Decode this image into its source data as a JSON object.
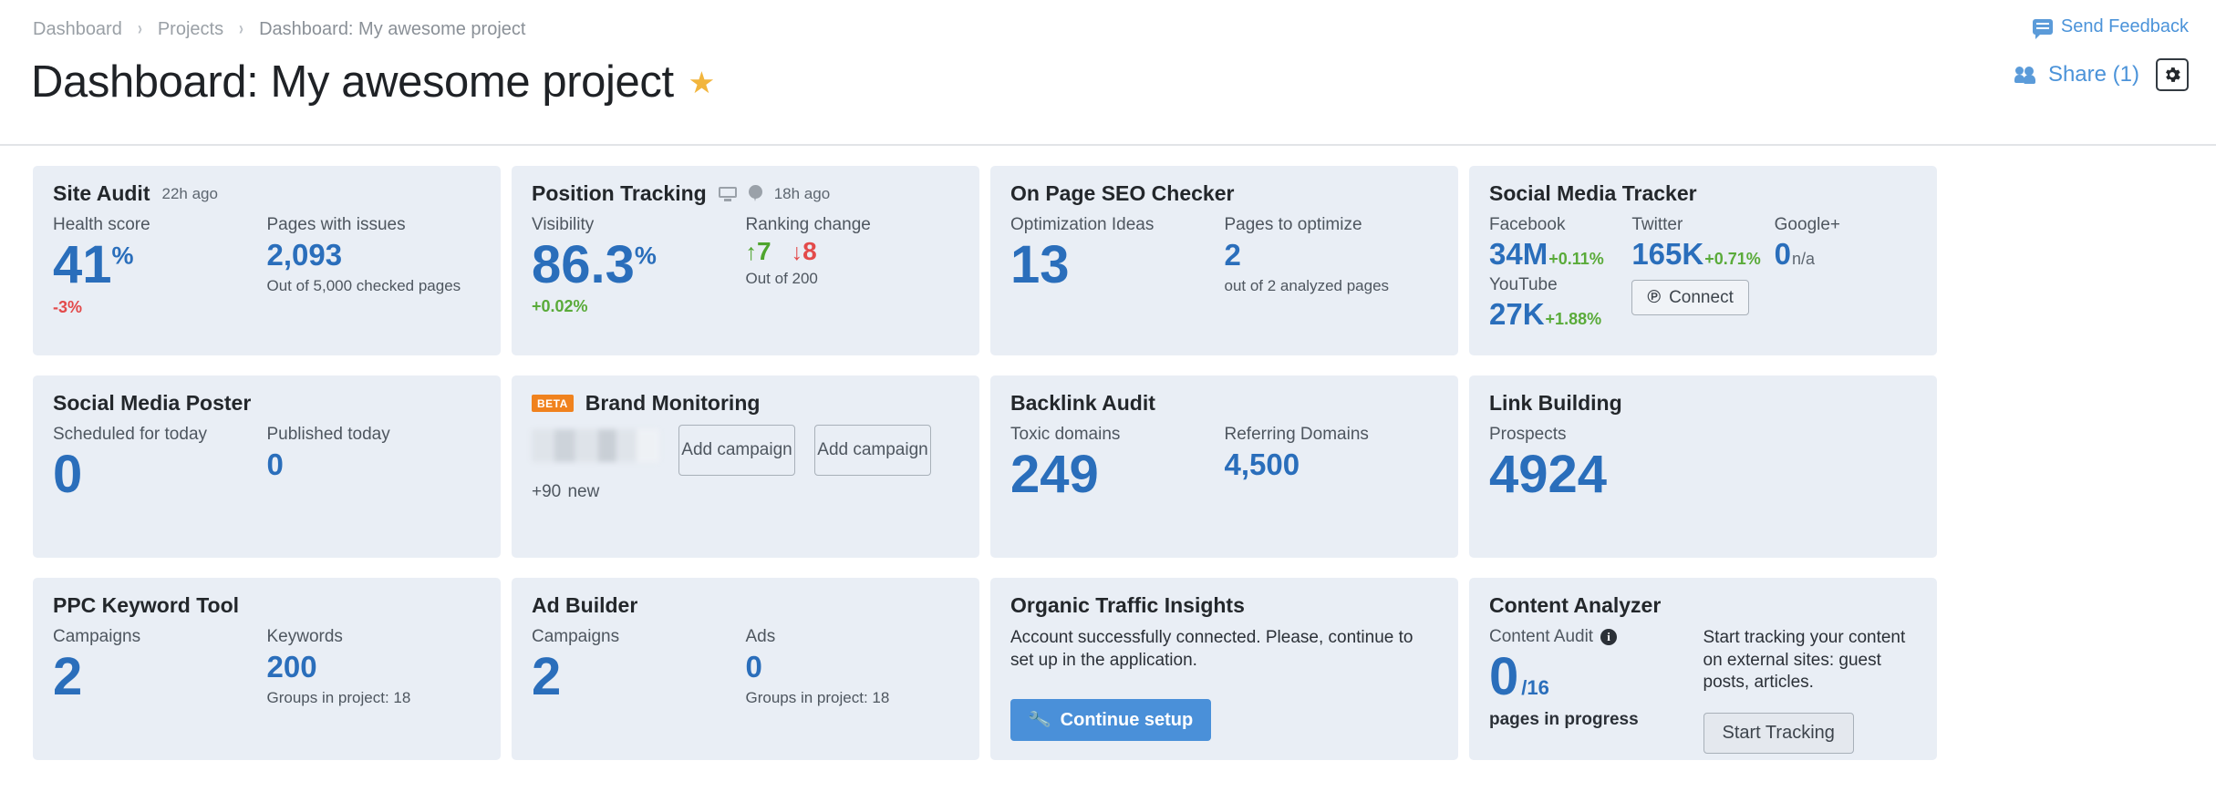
{
  "breadcrumb": {
    "items": [
      "Dashboard",
      "Projects",
      "Dashboard: My awesome project"
    ],
    "separator": "›"
  },
  "header": {
    "title": "Dashboard: My awesome project",
    "star": "★",
    "feedback_label": "Send Feedback",
    "share_label": "Share (1)",
    "gear_name": "settings"
  },
  "cards": {
    "site_audit": {
      "title": "Site Audit",
      "time": "22h ago",
      "health_label": "Health score",
      "health_value": "41",
      "health_unit": "%",
      "health_delta": "-3%",
      "pages_label": "Pages with issues",
      "pages_value": "2,093",
      "pages_sub": "Out of 5,000 checked pages"
    },
    "position_tracking": {
      "title": "Position Tracking",
      "time": "18h ago",
      "visibility_label": "Visibility",
      "visibility_value": "86.3",
      "visibility_unit": "%",
      "visibility_delta": "+0.02%",
      "ranking_label": "Ranking change",
      "rank_up_arrow": "↑",
      "rank_up": "7",
      "rank_down_arrow": "↓",
      "rank_down": "8",
      "ranking_sub": "Out of 200"
    },
    "on_page_seo": {
      "title": "On Page SEO Checker",
      "ideas_label": "Optimization Ideas",
      "ideas_value": "13",
      "pages_label": "Pages to optimize",
      "pages_value": "2",
      "pages_sub": "out of 2 analyzed pages"
    },
    "social_media_tracker": {
      "title": "Social Media Tracker",
      "networks": [
        {
          "name": "Facebook",
          "value": "34M",
          "delta": "+0.11%",
          "delta_type": "up"
        },
        {
          "name": "Twitter",
          "value": "165K",
          "delta": "+0.71%",
          "delta_type": "up"
        },
        {
          "name": "Google+",
          "value": "0",
          "delta": "n/a",
          "delta_type": "na"
        },
        {
          "name": "YouTube",
          "value": "27K",
          "delta": "+1.88%",
          "delta_type": "up"
        }
      ],
      "connect_label": "Connect",
      "connect_icon_glyph": "℗"
    },
    "social_media_poster": {
      "title": "Social Media Poster",
      "scheduled_label": "Scheduled for today",
      "scheduled_value": "0",
      "published_label": "Published today",
      "published_value": "0"
    },
    "brand_monitoring": {
      "title": "Brand Monitoring",
      "badge": "BETA",
      "add_campaign_1": "Add campaign",
      "add_campaign_2": "Add campaign",
      "new_count": "+90",
      "new_label": "new"
    },
    "backlink_audit": {
      "title": "Backlink Audit",
      "toxic_label": "Toxic domains",
      "toxic_value": "249",
      "referring_label": "Referring Domains",
      "referring_value": "4,500"
    },
    "link_building": {
      "title": "Link Building",
      "prospects_label": "Prospects",
      "prospects_value": "4924"
    },
    "ppc_keyword_tool": {
      "title": "PPC Keyword Tool",
      "campaigns_label": "Campaigns",
      "campaigns_value": "2",
      "keywords_label": "Keywords",
      "keywords_value": "200",
      "groups_sub": "Groups in project: 18"
    },
    "ad_builder": {
      "title": "Ad Builder",
      "campaigns_label": "Campaigns",
      "campaigns_value": "2",
      "ads_label": "Ads",
      "ads_value": "0",
      "groups_sub": "Groups in project: 18"
    },
    "organic_traffic_insights": {
      "title": "Organic Traffic Insights",
      "message": "Account successfully connected. Please, continue to set up in the application.",
      "button_label": "Continue setup",
      "button_icon_glyph": "🔧"
    },
    "content_analyzer": {
      "title": "Content Analyzer",
      "audit_label": "Content Audit",
      "info_glyph": "i",
      "audit_value": "0",
      "audit_total": "/16",
      "audit_sub": "pages in progress",
      "description": "Start tracking your content on external sites: guest posts, articles.",
      "button_label": "Start Tracking"
    }
  },
  "colors": {
    "accent_blue": "#2a6ebb",
    "link_blue": "#4b93d9",
    "card_bg": "#e9eef5",
    "positive_green": "#5aab3a",
    "negative_red": "#e34a4a",
    "beta_orange": "#f0821e",
    "star_gold": "#f2b53c"
  }
}
